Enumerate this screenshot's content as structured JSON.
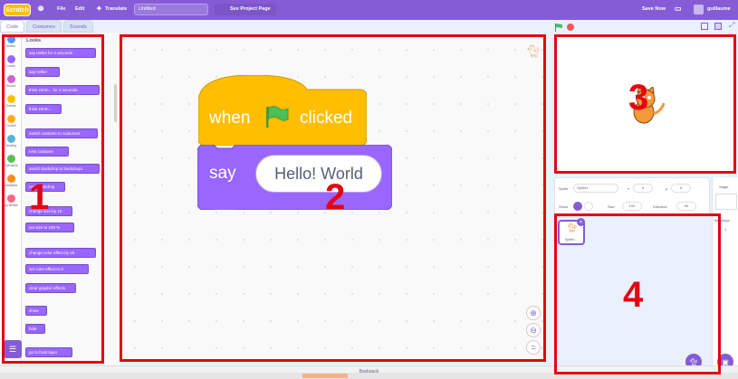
{
  "menubar": {
    "logo": "Scratch",
    "file": "File",
    "edit": "Edit",
    "translate": "Translate",
    "project_title": "Untitled",
    "see_project_page": "See Project Page",
    "save_now": "Save Now",
    "username": "guillaume"
  },
  "tabs": [
    {
      "label": "Code"
    },
    {
      "label": "Costumes"
    },
    {
      "label": "Sounds"
    }
  ],
  "categories": [
    {
      "label": "Motion",
      "color": "#4c97ff"
    },
    {
      "label": "Looks",
      "color": "#9966ff"
    },
    {
      "label": "Sound",
      "color": "#cf63cf"
    },
    {
      "label": "Events",
      "color": "#ffbf00"
    },
    {
      "label": "Control",
      "color": "#ffab19"
    },
    {
      "label": "Sensing",
      "color": "#5cb1d6"
    },
    {
      "label": "Operators",
      "color": "#59c059"
    },
    {
      "label": "Variables",
      "color": "#ff8c1a"
    },
    {
      "label": "My Blocks",
      "color": "#ff6680"
    }
  ],
  "palette": {
    "title": "Looks",
    "blocks": [
      "say Hello! for 2 seconds",
      "say Hello!",
      "think Hmm... for 2 seconds",
      "think Hmm...",
      "switch costume to costume2",
      "next costume",
      "switch backdrop to backdrop1",
      "next backdrop",
      "change size by 10",
      "set size to 100 %",
      "change color effect by 25",
      "set color effect to 0",
      "clear graphic effects",
      "show",
      "hide",
      "go to front layer"
    ]
  },
  "script": {
    "hat_when": "when",
    "hat_clicked": "clicked",
    "say_label": "say",
    "say_value": "Hello! World"
  },
  "sprite_info": {
    "sprite_label": "Sprite",
    "sprite_name": "Sprite1",
    "x_label": "x",
    "x_value": "0",
    "y_label": "y",
    "y_value": "0",
    "show_label": "Show",
    "size_label": "Size",
    "size_value": "100",
    "direction_label": "Direction",
    "direction_value": "90"
  },
  "sprite_list": [
    {
      "name": "Sprite1"
    }
  ],
  "stage_panel": {
    "label": "Stage",
    "backdrops_label": "Backdrops",
    "backdrops_count": "1"
  },
  "backpack": "Backpack",
  "annotations": [
    "1",
    "2",
    "3",
    "4"
  ],
  "colors": {
    "accent": "#855cd6",
    "events": "#ffbf00",
    "looks": "#9966ff",
    "annotation": "#e30613"
  }
}
